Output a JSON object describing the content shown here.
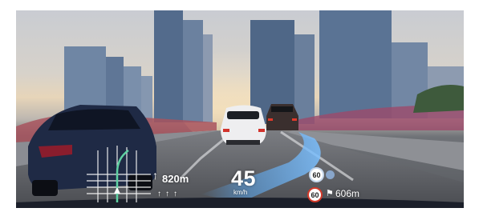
{
  "hud": {
    "speed": {
      "value": "45",
      "unit": "km/h"
    },
    "navigation": {
      "turn_arrow": "↑",
      "distance": "820m",
      "lane_arrows": "↑↑↑"
    },
    "speed_limits": {
      "upper": "60",
      "lower": "60"
    },
    "camera": {
      "distance": "606m",
      "icon": "flag-icon"
    },
    "colors": {
      "guide_path": "#5aa3e8",
      "limit_ring": "#d23a2a",
      "hud_text": "#ffffff"
    }
  }
}
